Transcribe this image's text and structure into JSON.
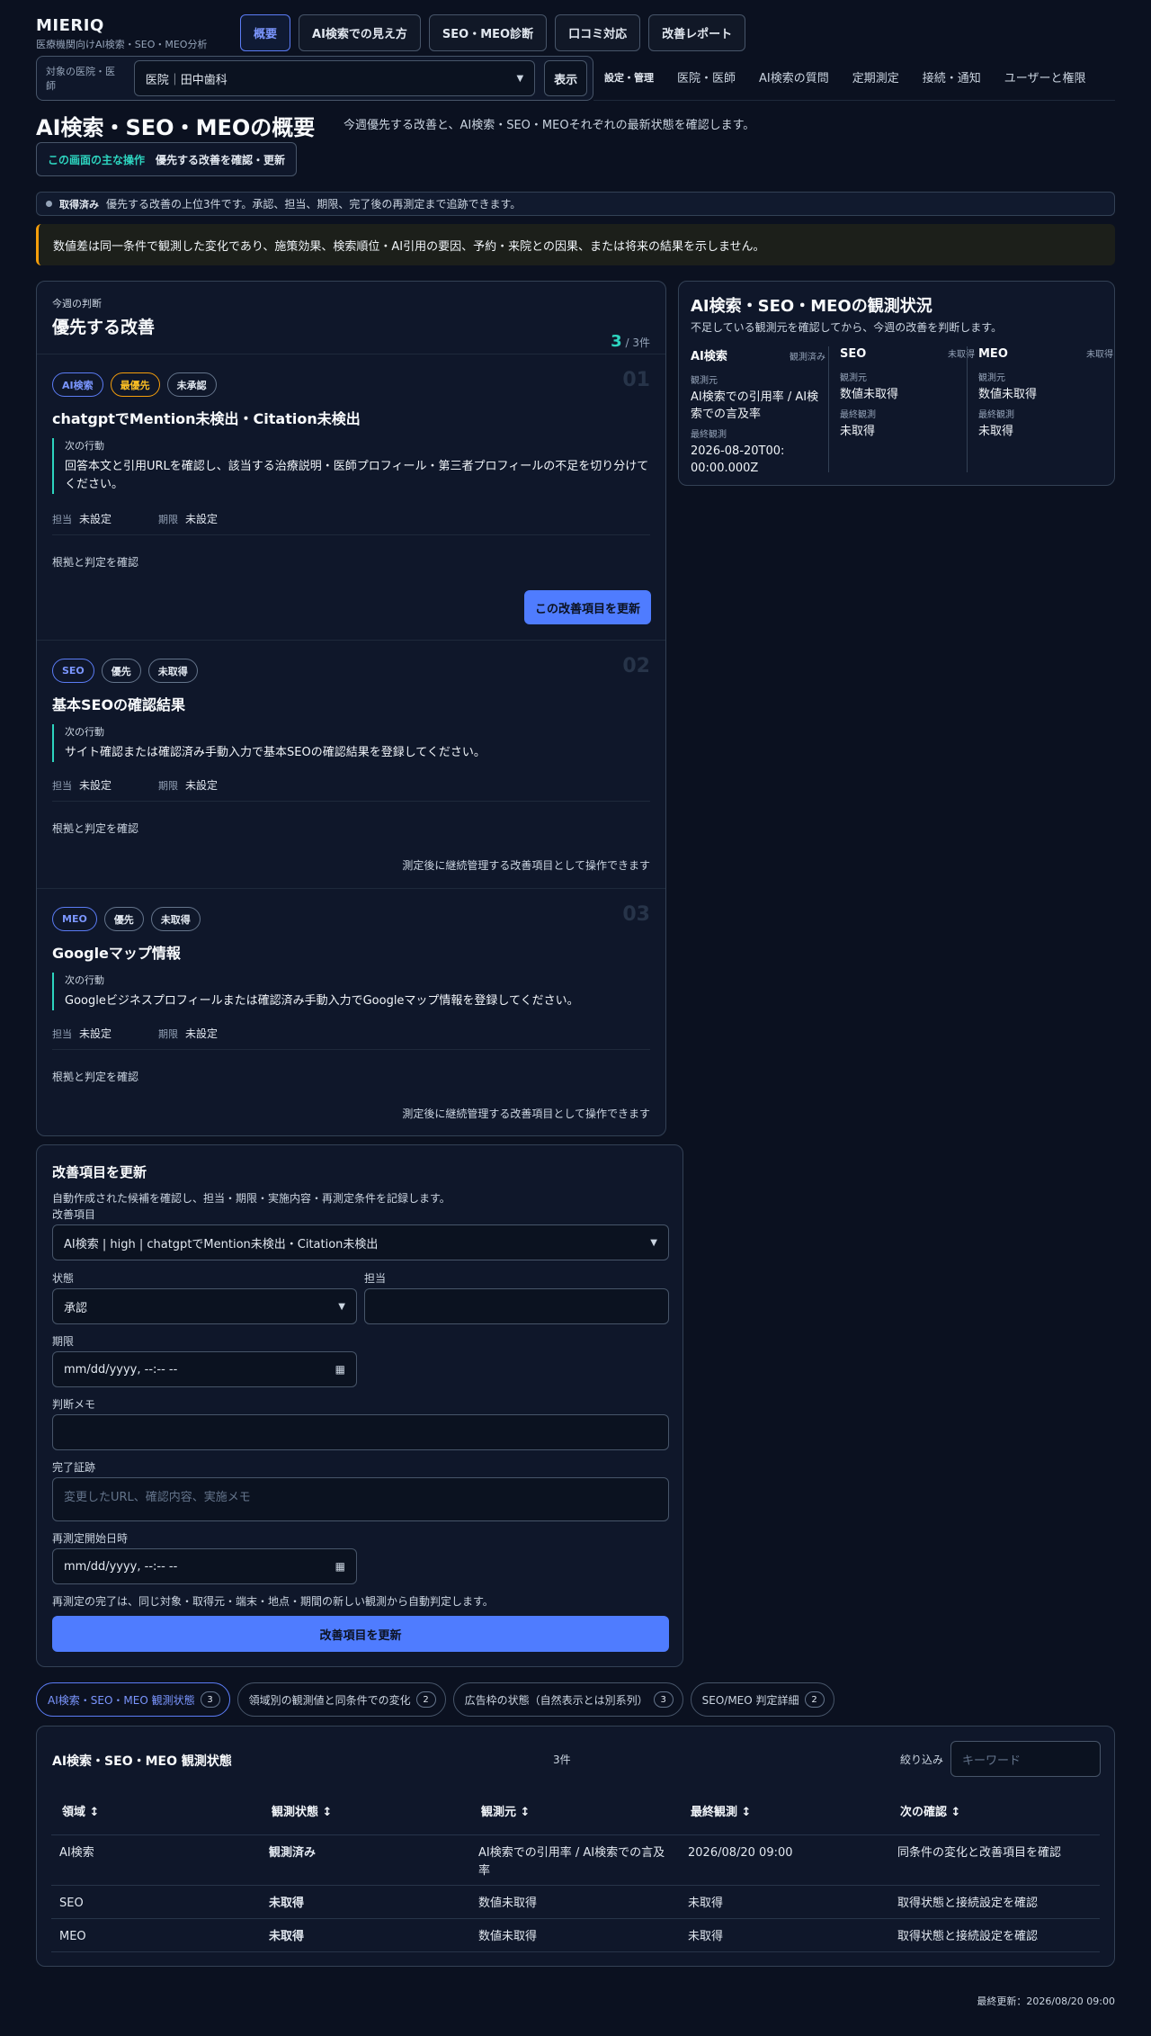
{
  "brand": {
    "name": "MIERIQ",
    "subtitle": "医療機関向けAI検索・SEO・MEO分析"
  },
  "topnav": [
    "概要",
    "AI検索での見え方",
    "SEO・MEO診断",
    "口コミ対応",
    "改善レポート"
  ],
  "selector": {
    "label": "対象の医院・医師",
    "value": "医院｜田中歯科",
    "show": "表示"
  },
  "subnav": {
    "heading": "設定・管理",
    "items": [
      "医院・医師",
      "AI検索の質問",
      "定期測定",
      "接続・通知",
      "ユーザーと権限"
    ]
  },
  "page": {
    "title": "AI検索・SEO・MEOの概要",
    "description": "今週優先する改善と、AI検索・SEO・MEOそれぞれの最新状態を確認します。",
    "main_op_label": "この画面の主な操作",
    "main_op_value": "優先する改善を確認・更新"
  },
  "status": {
    "label": "取得済み",
    "text": "優先する改善の上位3件です。承認、担当、期限、完了後の再測定まで追跡できます。"
  },
  "warning": "数値差は同一条件で観測した変化であり、施策効果、検索順位・AI引用の要因、予約・来院との因果、または将来の結果を示しません。",
  "priority": {
    "small": "今週の判断",
    "title": "優先する改善",
    "count": "3",
    "total": "/ 3件",
    "cards": [
      {
        "tags": [
          "AI検索",
          "最優先",
          "未承認"
        ],
        "num": "01",
        "title": "chatgptでMention未検出・Citation未検出",
        "action_label": "次の行動",
        "action": "回答本文と引用URLを確認し、該当する治療説明・医師プロフィール・第三者プロフィールの不足を切り分けてください。",
        "owner_label": "担当",
        "owner": "未設定",
        "due_label": "期限",
        "due": "未設定",
        "evidence": "根拠と判定を確認",
        "button": "この改善項目を更新"
      },
      {
        "tags": [
          "SEO",
          "優先",
          "未取得"
        ],
        "num": "02",
        "title": "基本SEOの確認結果",
        "action_label": "次の行動",
        "action": "サイト確認または確認済み手動入力で基本SEOの確認結果を登録してください。",
        "owner_label": "担当",
        "owner": "未設定",
        "due_label": "期限",
        "due": "未設定",
        "evidence": "根拠と判定を確認",
        "note": "測定後に継続管理する改善項目として操作できます"
      },
      {
        "tags": [
          "MEO",
          "優先",
          "未取得"
        ],
        "num": "03",
        "title": "Googleマップ情報",
        "action_label": "次の行動",
        "action": "Googleビジネスプロフィールまたは確認済み手動入力でGoogleマップ情報を登録してください。",
        "owner_label": "担当",
        "owner": "未設定",
        "due_label": "期限",
        "due": "未設定",
        "evidence": "根拠と判定を確認",
        "note": "測定後に継続管理する改善項目として操作できます"
      }
    ]
  },
  "observation": {
    "title": "AI検索・SEO・MEOの観測状況",
    "description": "不足している観測元を確認してから、今週の改善を判断します。",
    "columns": [
      {
        "name": "AI検索",
        "state": "観測済み",
        "src_label": "観測元",
        "src": "AI検索での引用率 / AI検索での言及率",
        "last_label": "最終観測",
        "last": "2026-08-20T00:00:00.000Z"
      },
      {
        "name": "SEO",
        "state": "未取得",
        "src_label": "観測元",
        "src": "数値未取得",
        "last_label": "最終観測",
        "last": "未取得"
      },
      {
        "name": "MEO",
        "state": "未取得",
        "src_label": "観測元",
        "src": "数値未取得",
        "last_label": "最終観測",
        "last": "未取得"
      }
    ]
  },
  "form": {
    "title": "改善項目を更新",
    "description": "自動作成された候補を確認し、担当・期限・実施内容・再測定条件を記録します。",
    "item_label": "改善項目",
    "item_value": "AI検索 | high | chatgptでMention未検出・Citation未検出",
    "status_label": "状態",
    "status_value": "承認",
    "owner_label": "担当",
    "due_label": "期限",
    "datetime_placeholder": "mm/dd/yyyy, --:-- --",
    "memo_label": "判断メモ",
    "evidence_label": "完了証跡",
    "evidence_placeholder": "変更したURL、確認内容、実施メモ",
    "remeasure_label": "再測定開始日時",
    "note": "再測定の完了は、同じ対象・取得元・端末・地点・期間の新しい観測から自動判定します。",
    "submit": "改善項目を更新"
  },
  "tabs": [
    {
      "label": "AI検索・SEO・MEO 観測状態",
      "count": "3"
    },
    {
      "label": "領域別の観測値と同条件での変化",
      "count": "2"
    },
    {
      "label": "広告枠の状態（自然表示とは別系列）",
      "count": "3"
    },
    {
      "label": "SEO/MEO 判定詳細",
      "count": "2"
    }
  ],
  "table": {
    "title": "AI検索・SEO・MEO 観測状態",
    "count": "3件",
    "filter_label": "絞り込み",
    "keyword_placeholder": "キーワード",
    "headers": [
      "領域 ↕",
      "観測状態 ↕",
      "観測元 ↕",
      "最終観測 ↕",
      "次の確認 ↕"
    ],
    "rows": [
      [
        "AI検索",
        "観測済み",
        "AI検索での引用率 / AI検索での言及率",
        "2026/08/20 09:00",
        "同条件の変化と改善項目を確認"
      ],
      [
        "SEO",
        "未取得",
        "数値未取得",
        "未取得",
        "取得状態と接続設定を確認"
      ],
      [
        "MEO",
        "未取得",
        "数値未取得",
        "未取得",
        "取得状態と接続設定を確認"
      ]
    ]
  },
  "footer": {
    "last_updated": "最終更新：2026/08/20 09:00"
  },
  "colors": {
    "accent": "#4f7cff",
    "teal": "#2dd4bf",
    "warning": "#f59e0b",
    "bg": "#0b1120"
  }
}
